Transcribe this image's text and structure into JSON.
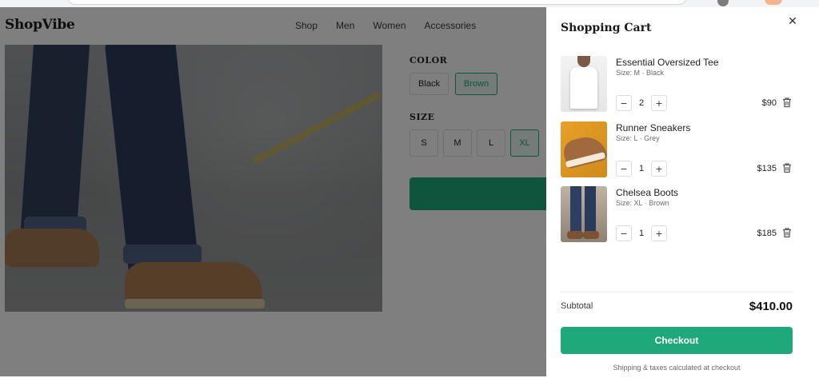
{
  "brand": "ShopVibe",
  "nav": [
    "Shop",
    "Men",
    "Women",
    "Accessories"
  ],
  "product": {
    "color_label": "COLOR",
    "colors": [
      "Black",
      "Brown"
    ],
    "selected_color": "Brown",
    "size_label": "SIZE",
    "sizes": [
      "S",
      "M",
      "L",
      "XL"
    ],
    "selected_size": "XL"
  },
  "cart": {
    "title": "Shopping Cart",
    "items": [
      {
        "name": "Essential Oversized Tee",
        "meta": "Size: M · Black",
        "qty": "2",
        "price": "$90"
      },
      {
        "name": "Runner Sneakers",
        "meta": "Size: L · Grey",
        "qty": "1",
        "price": "$135"
      },
      {
        "name": "Chelsea Boots",
        "meta": "Size: XL · Brown",
        "qty": "1",
        "price": "$185"
      }
    ],
    "subtotal_label": "Subtotal",
    "subtotal_value": "$410.00",
    "checkout_label": "Checkout",
    "note": "Shipping & taxes calculated at checkout"
  },
  "colors": {
    "accent": "#1fa87a",
    "overlay": "rgba(0,0,0,0.5)"
  }
}
